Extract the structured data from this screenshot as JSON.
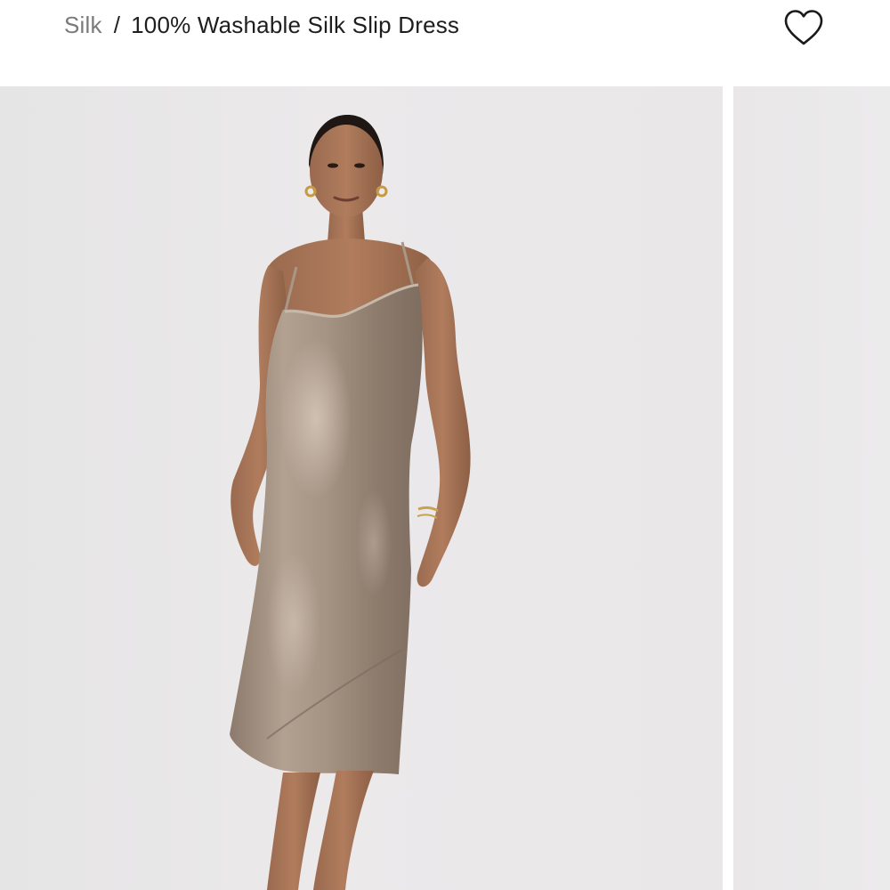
{
  "breadcrumb": {
    "parent_label": "Silk",
    "separator": "/",
    "current_label": "100% Washable Silk Slip Dress"
  },
  "header": {
    "wishlist_icon": "heart-outline-icon"
  },
  "gallery": {
    "slides": [
      {
        "kind": "product-photo",
        "subject": "model wearing taupe silk slip dress"
      },
      {
        "kind": "product-photo",
        "subject": "next gallery image (partially visible)"
      }
    ]
  },
  "colors": {
    "text_primary": "#1e1e1e",
    "text_muted": "#7a7a7a",
    "background": "#ffffff",
    "photo_background": "#e9e7e8",
    "dress": "#9c8a7b"
  }
}
